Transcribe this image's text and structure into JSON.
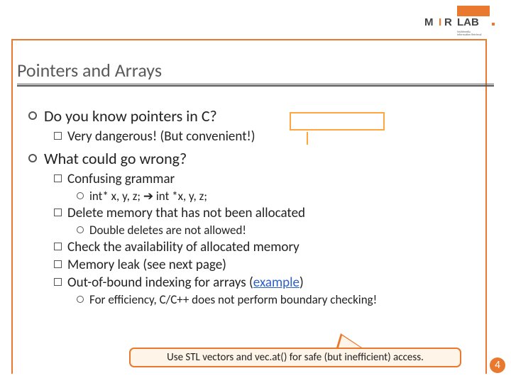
{
  "logo": {
    "top_fill": "#e8792f",
    "text": "LAB"
  },
  "title": "Pointers and Arrays",
  "bullets": [
    {
      "text": "Do you know pointers in C?",
      "children": [
        {
          "text": "Very dangerous! (But convenient!)"
        }
      ]
    },
    {
      "text": "What could go wrong?",
      "children": [
        {
          "text": "Confusing grammar",
          "children": [
            {
              "text_a": "int* x, y, z; ",
              "arrow": "➔",
              "text_b": " int *x, y, z;"
            }
          ]
        },
        {
          "text": "Delete memory that has not been allocated",
          "children": [
            {
              "text_a": "Double deletes are not allowed!"
            }
          ]
        },
        {
          "text": "Check the availability of allocated memory"
        },
        {
          "text": "Memory leak (see next page)"
        },
        {
          "text_a": "Out-of-bound indexing for arrays (",
          "link": "example",
          "text_b": ")",
          "children": [
            {
              "text_a": "For efficiency, C/C++ does not perform boundary checking!"
            }
          ]
        }
      ]
    }
  ],
  "callout": "Use STL vectors and vec.at() for safe (but inefficient) access.",
  "page_number": "4"
}
